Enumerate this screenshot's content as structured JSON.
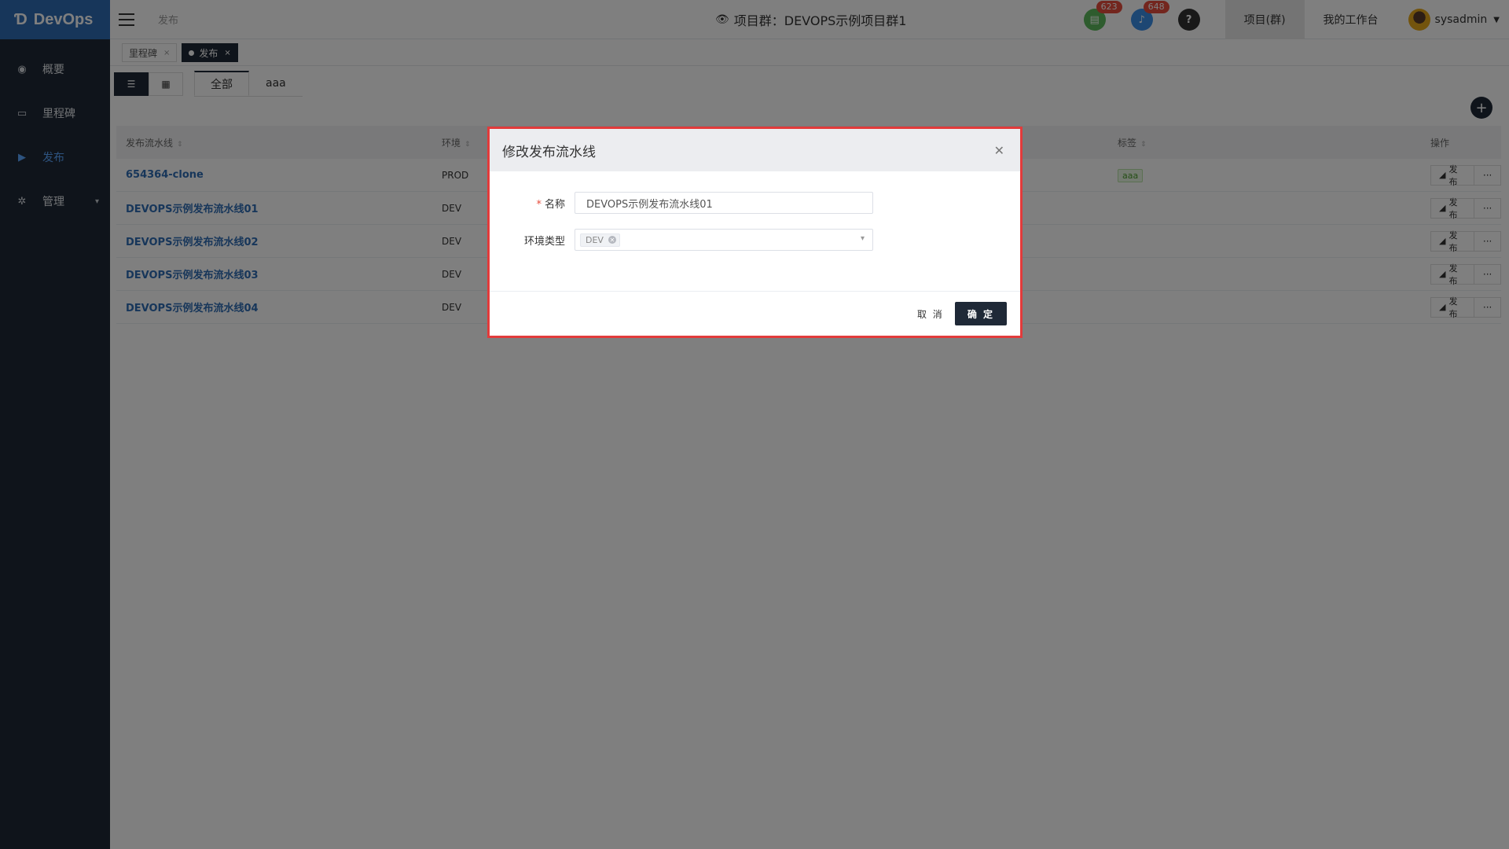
{
  "app": {
    "brand": "DevOps"
  },
  "sidebar": {
    "items": [
      {
        "label": "概要",
        "icon": "dashboard-icon"
      },
      {
        "label": "里程碑",
        "icon": "folder-icon"
      },
      {
        "label": "发布",
        "icon": "publish-icon",
        "active": true
      },
      {
        "label": "管理",
        "icon": "gear-icon"
      }
    ]
  },
  "header": {
    "breadcrumb": "发布",
    "project_title": "项目群：DEVOPS示例项目群1",
    "badges": {
      "tasks": "623",
      "notifications": "648"
    },
    "help": "?",
    "tabs": [
      "项目(群)",
      "我的工作台"
    ],
    "user": "sysadmin"
  },
  "tabs": [
    {
      "label": "里程碑",
      "close": "×"
    },
    {
      "label": "发布",
      "close": "×",
      "active": true
    }
  ],
  "filters": [
    "全部",
    "aaa"
  ],
  "table": {
    "headers": [
      "发布流水线",
      "环境",
      "",
      "标签",
      "操作"
    ],
    "rows": [
      {
        "name": "654364-clone",
        "env": "PROD",
        "tag": "aaa"
      },
      {
        "name": "DEVOPS示例发布流水线01",
        "env": "DEV",
        "tag": ""
      },
      {
        "name": "DEVOPS示例发布流水线02",
        "env": "DEV",
        "tag": ""
      },
      {
        "name": "DEVOPS示例发布流水线03",
        "env": "DEV",
        "tag": ""
      },
      {
        "name": "DEVOPS示例发布流水线04",
        "env": "DEV",
        "tag": ""
      }
    ],
    "action_label": "发布",
    "more_label": "···"
  },
  "modal": {
    "title": "修改发布流水线",
    "name_label": "名称",
    "name_value": "DEVOPS示例发布流水线01",
    "env_label": "环境类型",
    "env_chip": "DEV",
    "cancel": "取 消",
    "ok": "确 定"
  },
  "colors": {
    "sidebar": "#1f2937",
    "brand": "#2f6db5",
    "highlight": "#e23b3b"
  }
}
